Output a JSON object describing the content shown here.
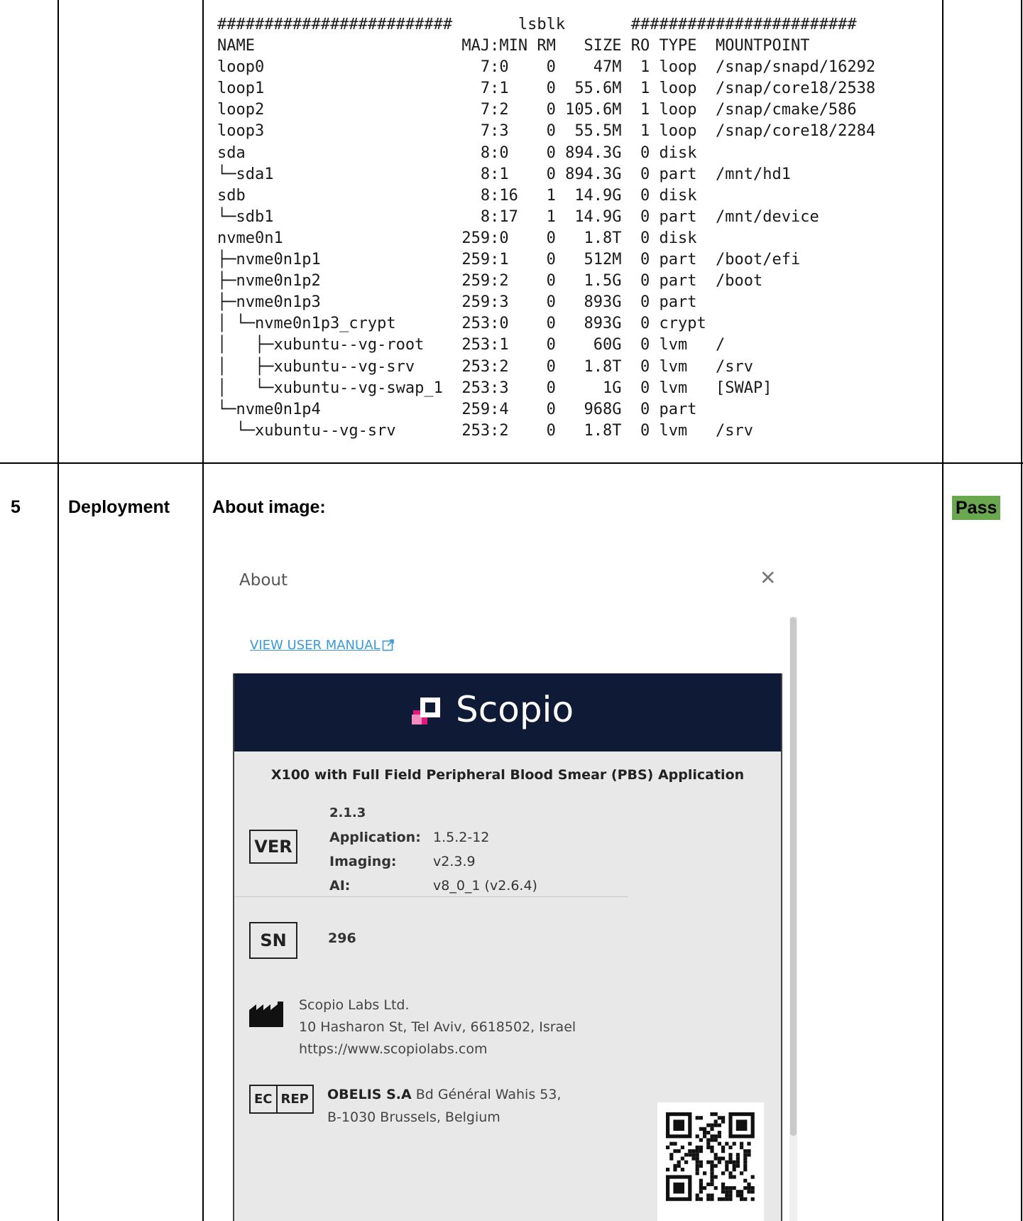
{
  "terminal": {
    "lines": [
      "#########################       lsblk       ########################",
      "NAME                      MAJ:MIN RM   SIZE RO TYPE  MOUNTPOINT",
      "loop0                       7:0    0    47M  1 loop  /snap/snapd/16292",
      "loop1                       7:1    0  55.6M  1 loop  /snap/core18/2538",
      "loop2                       7:2    0 105.6M  1 loop  /snap/cmake/586",
      "loop3                       7:3    0  55.5M  1 loop  /snap/core18/2284",
      "sda                         8:0    0 894.3G  0 disk",
      "└─sda1                      8:1    0 894.3G  0 part  /mnt/hd1",
      "sdb                         8:16   1  14.9G  0 disk",
      "└─sdb1                      8:17   1  14.9G  0 part  /mnt/device",
      "nvme0n1                   259:0    0   1.8T  0 disk",
      "├─nvme0n1p1               259:1    0   512M  0 part  /boot/efi",
      "├─nvme0n1p2               259:2    0   1.5G  0 part  /boot",
      "├─nvme0n1p3               259:3    0   893G  0 part",
      "│ └─nvme0n1p3_crypt       253:0    0   893G  0 crypt",
      "│   ├─xubuntu--vg-root    253:1    0    60G  0 lvm   /",
      "│   ├─xubuntu--vg-srv     253:2    0   1.8T  0 lvm   /srv",
      "│   └─xubuntu--vg-swap_1  253:3    0     1G  0 lvm   [SWAP]",
      "└─nvme0n1p4               259:4    0   968G  0 part",
      "  └─xubuntu--vg-srv       253:2    0   1.8T  0 lvm   /srv"
    ]
  },
  "row5": {
    "number": "5",
    "phase": "Deployment",
    "label": "About image:",
    "status": "Pass",
    "status_color": "#6aa84f"
  },
  "about": {
    "title": "About",
    "close_icon": "close-icon",
    "manual_link": "VIEW USER MANUAL",
    "brand": "Scopio",
    "brand_bg": "#0f1b36",
    "product": "X100 with Full Field Peripheral Blood Smear (PBS) Application",
    "ver_symbol": "VER",
    "version": "2.1.3",
    "versions": [
      {
        "key": "Application:",
        "value": "1.5.2-12"
      },
      {
        "key": "Imaging:",
        "value": "v2.3.9"
      },
      {
        "key": "AI:",
        "value": "v8_0_1 (v2.6.4)"
      }
    ],
    "sn_symbol": "SN",
    "serial": "296",
    "manufacturer": [
      "Scopio Labs Ltd.",
      "10 Hasharon St, Tel Aviv, 6618502, Israel",
      "https://www.scopiolabs.com"
    ],
    "ec": "EC",
    "rep": "REP",
    "rep_name": "OBELIS S.A",
    "rep_addr1": " Bd Général Wahis 53,",
    "rep_addr2": "B-1030 Brussels, Belgium"
  }
}
